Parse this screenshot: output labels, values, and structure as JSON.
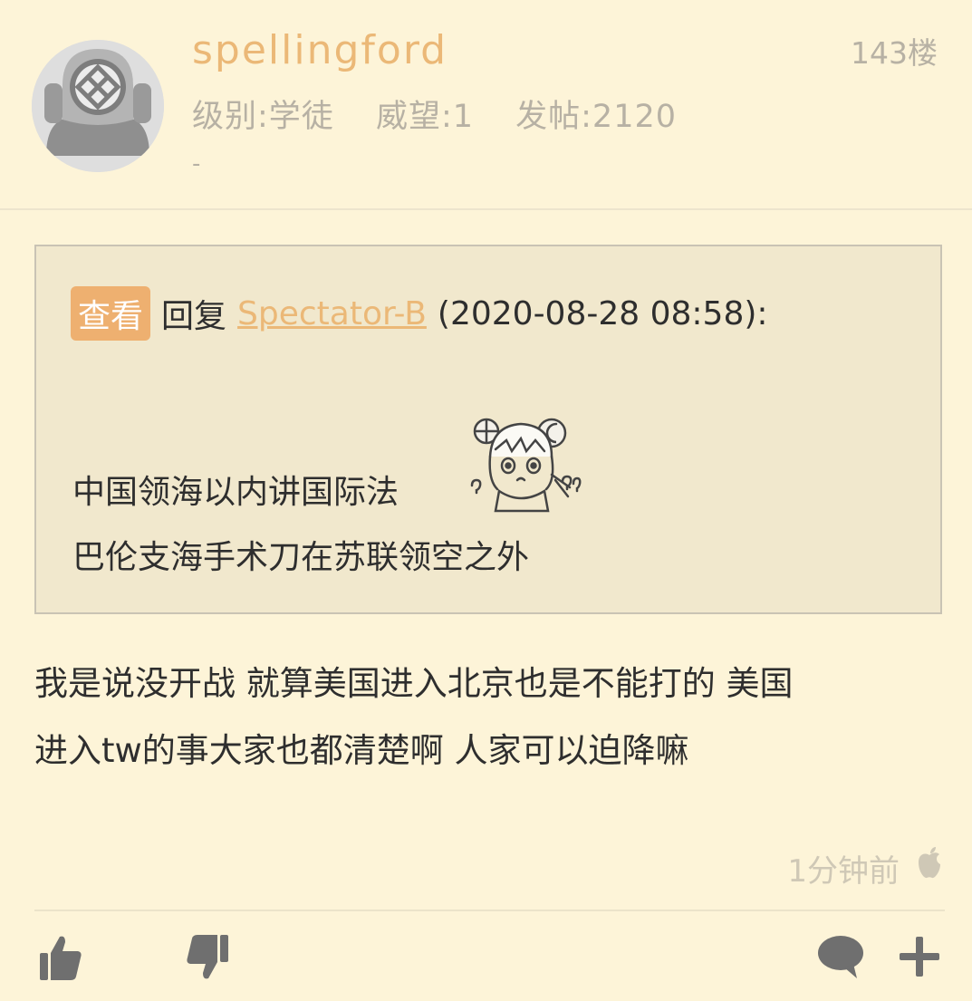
{
  "post": {
    "username": "spellingford",
    "level": "级别:学徒",
    "prestige": "威望:1",
    "posts": "发帖:2120",
    "signature": "-",
    "floor": "143楼"
  },
  "quote": {
    "view_label": "查看",
    "reply_label": "回复",
    "reply_user": "Spectator-B",
    "reply_time": "(2020-08-28 08:58):",
    "lines": [
      "中国领海以内讲国际法",
      "巴伦支海手术刀在苏联领空之外"
    ],
    "sticker_icon": "confused-anime-girl-sticker"
  },
  "body": {
    "lines": [
      "我是说没开战 就算美国进入北京也是不能打的 美国",
      "进入tw的事大家也都清楚啊 人家可以迫降嘛"
    ]
  },
  "footer": {
    "time_ago": "1分钟前",
    "device_icon": "apple-icon",
    "actions": [
      "thumbs-up-icon",
      "thumbs-down-icon",
      "comment-icon",
      "plus-icon"
    ]
  },
  "colors": {
    "background": "#fdf4d8",
    "accent": "#ebb877",
    "view_button": "#eeb070",
    "muted_text": "#b7b1a4",
    "quote_background": "#f1e8cd"
  }
}
